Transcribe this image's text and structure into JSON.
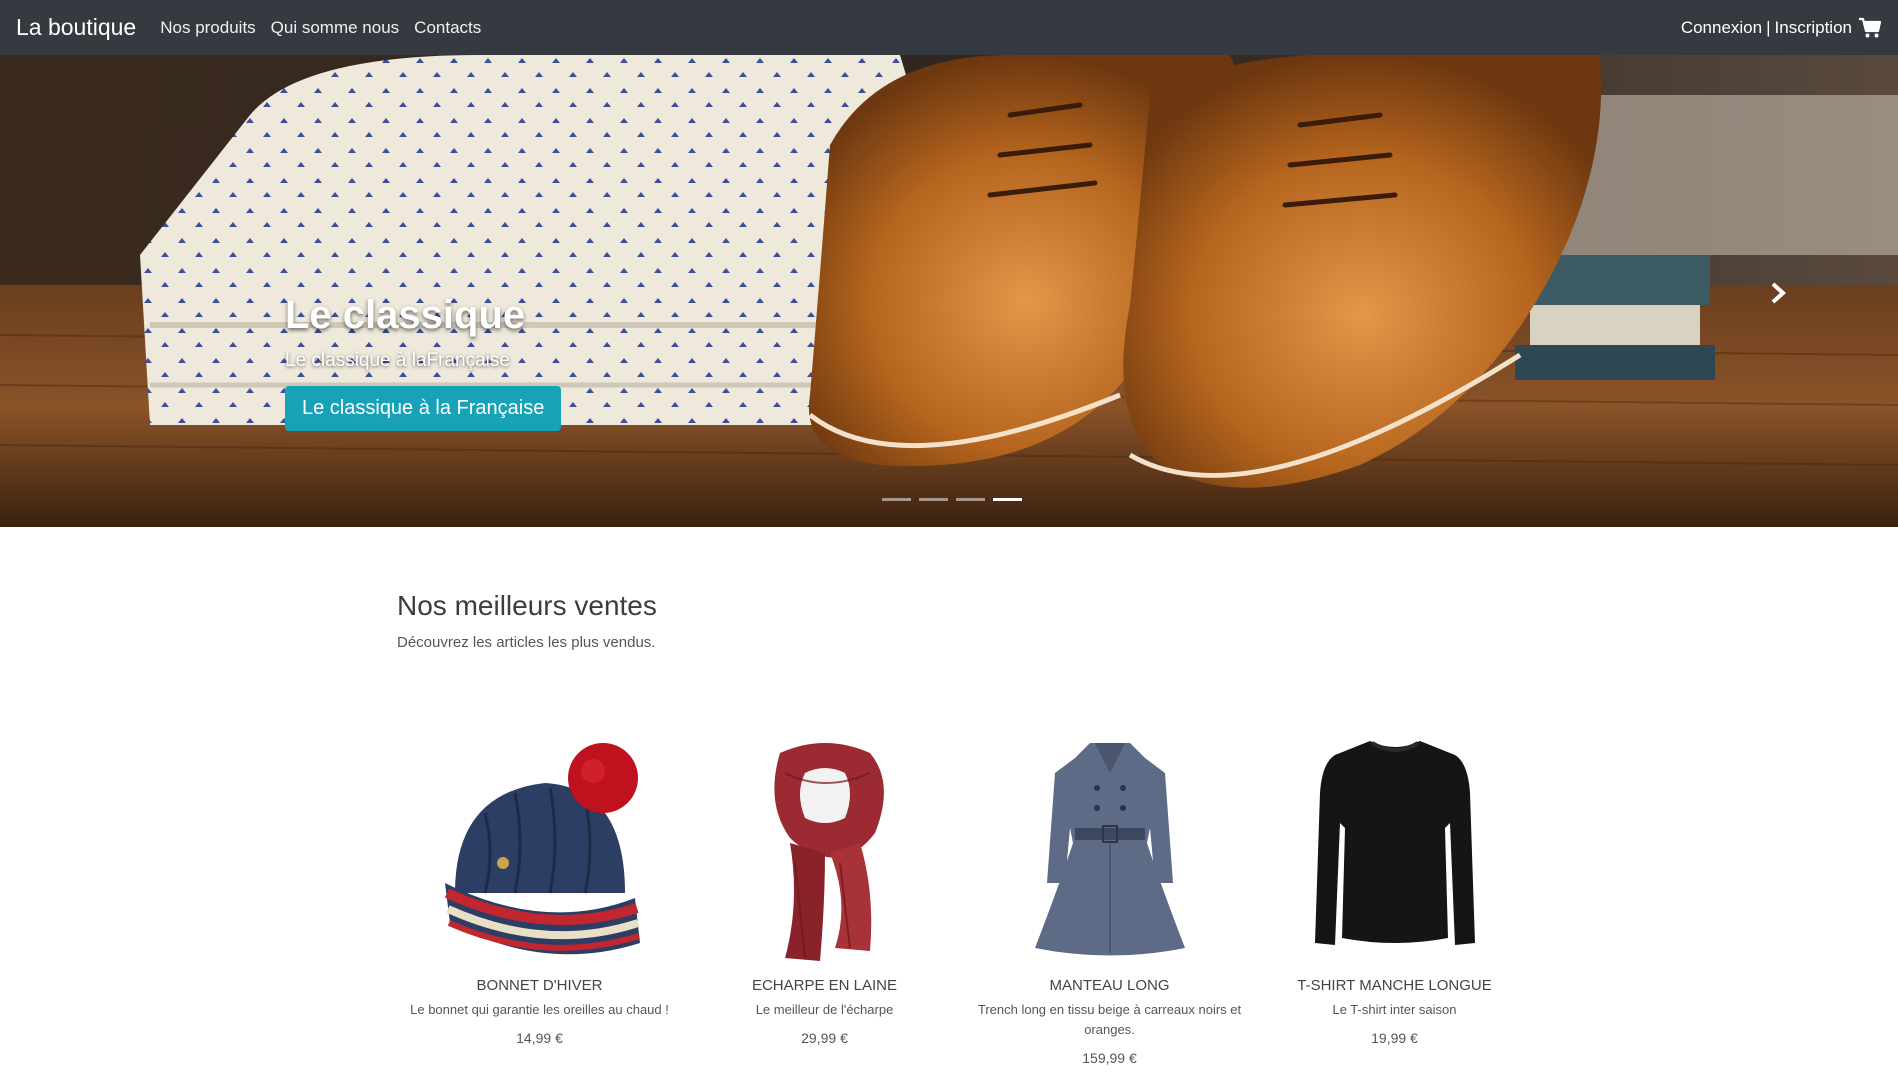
{
  "navbar": {
    "brand": "La boutique",
    "links": [
      "Nos produits",
      "Qui somme nous",
      "Contacts"
    ],
    "login": "Connexion",
    "separator": "|",
    "register": "Inscription",
    "cart_icon": "cart-icon"
  },
  "hero": {
    "title": "Le classique",
    "subtitle": "Le classique à laFrançaise",
    "button": "Le classique à la Française",
    "slides_count": 4,
    "active_slide": 4
  },
  "bestsellers": {
    "title": "Nos meilleurs ventes",
    "subtitle": "Découvrez les articles les plus vendus.",
    "products": [
      {
        "name": "Bonnet d'hiver",
        "desc": "Le bonnet qui garantie les oreilles au chaud !",
        "price": "14,99 €"
      },
      {
        "name": "Echarpe en laine",
        "desc": "Le meilleur de l'écharpe",
        "price": "29,99 €"
      },
      {
        "name": "Manteau long",
        "desc": "Trench long en tissu beige à carreaux noirs et oranges.",
        "price": "159,99 €"
      },
      {
        "name": "T-shirt manche longue",
        "desc": "Le T-shirt inter saison",
        "price": "19,99 €"
      }
    ]
  },
  "colors": {
    "navbar_bg": "#343a40",
    "button_bg": "#17a2b8"
  }
}
